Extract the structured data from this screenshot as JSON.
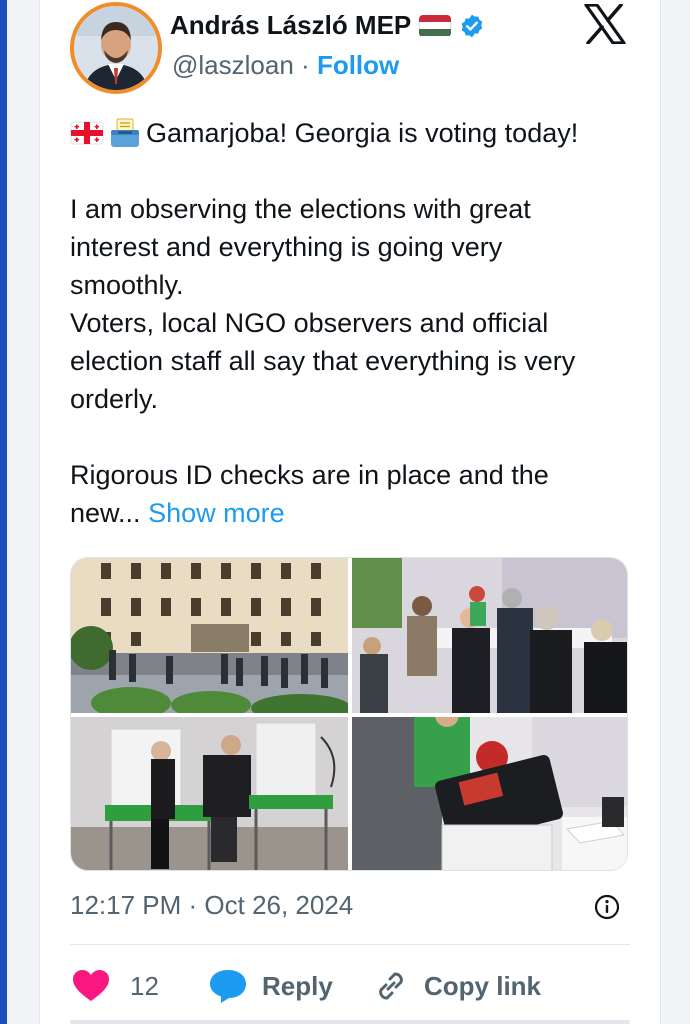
{
  "author": {
    "name": "András László MEP",
    "handle": "@laszloan",
    "separator": "·",
    "follow_label": "Follow",
    "flag_colors": [
      "#cd2a3e",
      "#ffffff",
      "#436f4d"
    ],
    "verified_color": "#1d9bf0"
  },
  "tweet": {
    "line1": "Gamarjoba! Georgia is voting today!",
    "para2": "I am observing the elections with great\ninterest and everything is going very\nsmoothly.\nVoters, local NGO observers and official\nelection staff all say that everything is very\norderly.",
    "para3_prefix": "Rigorous ID checks are in place and the\nnew...",
    "show_more": "Show more",
    "emojis": [
      "georgia-flag-icon",
      "ballot-box-icon"
    ]
  },
  "media": {
    "photo_count": 4
  },
  "meta": {
    "timestamp": "12:17 PM · Oct 26, 2024"
  },
  "actions": {
    "like_count": "12",
    "reply_label": "Reply",
    "copy_label": "Copy link",
    "like_color": "#f91880",
    "reply_color": "#1d9bf0"
  },
  "brand": {
    "logo": "x-logo-icon"
  }
}
